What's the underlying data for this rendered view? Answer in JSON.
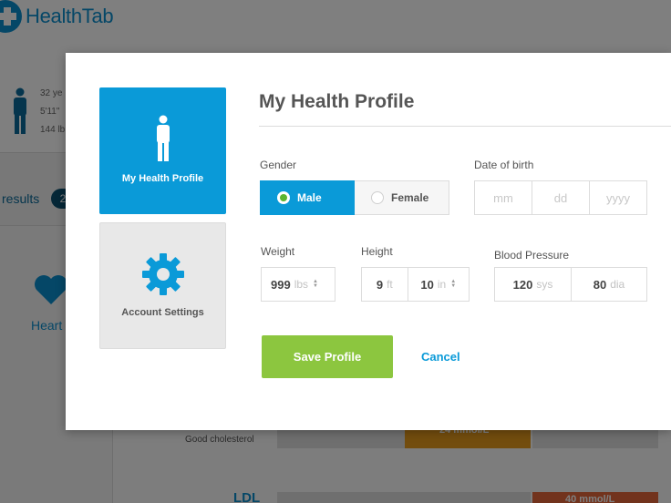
{
  "app": {
    "logo_text": "HealthTab"
  },
  "background": {
    "stats": {
      "age": "32 ye",
      "height": "5'11\"",
      "weight": "144 lb"
    },
    "results_label": "results",
    "results_badge": "2",
    "category_label": "Heart",
    "rows": [
      {
        "label": "Good cholesterol",
        "value": "24 mmol/L"
      },
      {
        "label": "LDL",
        "value": "40 mmol/L"
      }
    ]
  },
  "modal": {
    "tabs": [
      {
        "label": "My Health Profile",
        "icon": "person-icon",
        "active": true
      },
      {
        "label": "Account Settings",
        "icon": "gear-icon",
        "active": false
      }
    ],
    "title": "My Health Profile",
    "gender": {
      "label": "Gender",
      "options": [
        "Male",
        "Female"
      ],
      "selected": "Male"
    },
    "dob": {
      "label": "Date of birth",
      "placeholders": {
        "month": "mm",
        "day": "dd",
        "year": "yyyy"
      }
    },
    "weight": {
      "label": "Weight",
      "value": "999",
      "unit": "lbs"
    },
    "height": {
      "label": "Height",
      "feet": {
        "value": "9",
        "unit": "ft"
      },
      "inches": {
        "value": "10",
        "unit": "in"
      }
    },
    "blood_pressure": {
      "label": "Blood Pressure",
      "systolic": {
        "value": "120",
        "unit": "sys"
      },
      "diastolic": {
        "value": "80",
        "unit": "dia"
      }
    },
    "actions": {
      "save_label": "Save Profile",
      "cancel_label": "Cancel"
    }
  },
  "colors": {
    "brand_blue": "#0a9ad8",
    "save_green": "#8cc63f",
    "radio_green": "#5bb52f",
    "bar_orange": "#e69a1c",
    "bar_red": "#e5663a"
  }
}
